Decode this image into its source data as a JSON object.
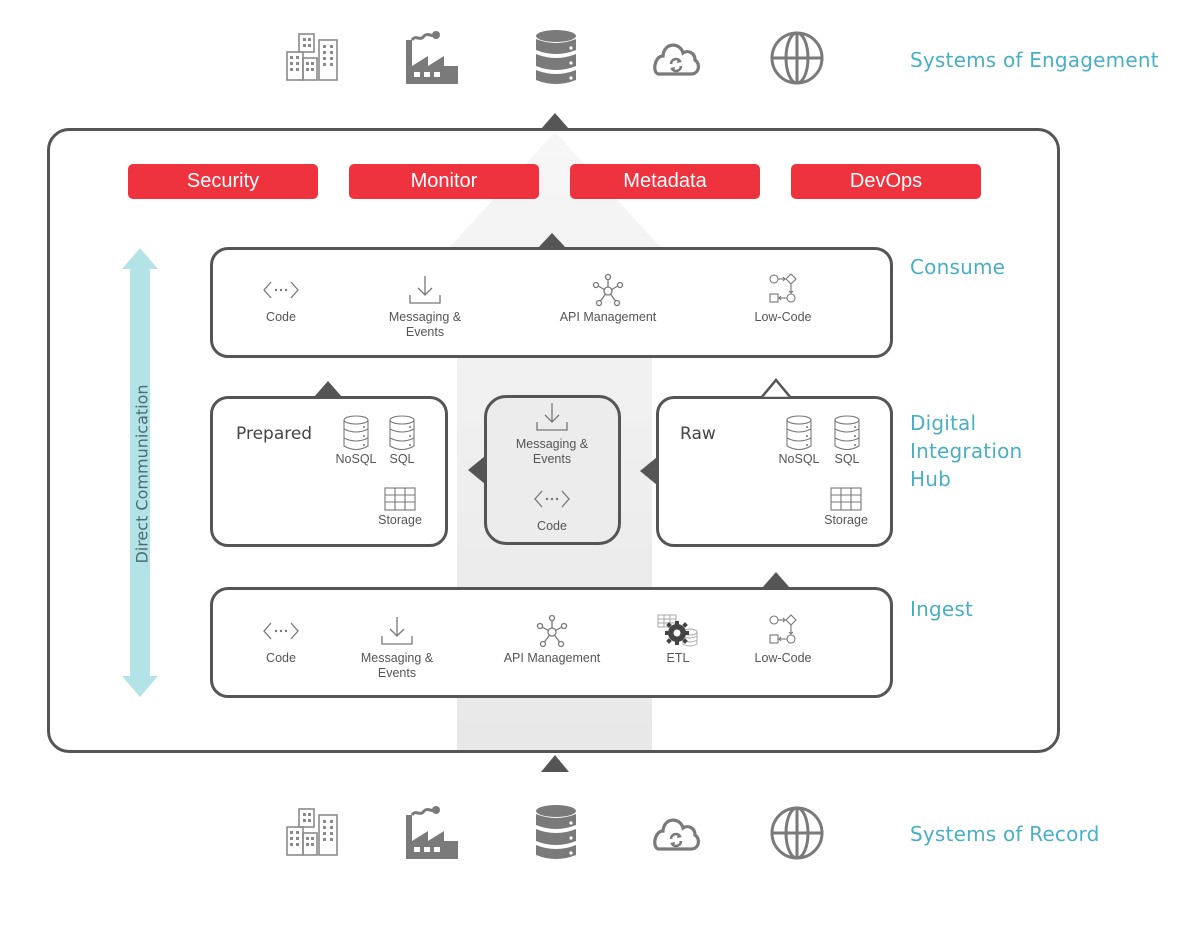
{
  "layers": {
    "engagement": "Systems of Engagement",
    "consume": "Consume",
    "hub_line1": "Digital",
    "hub_line2": "Integration",
    "hub_line3": "Hub",
    "ingest": "Ingest",
    "record": "Systems of Record"
  },
  "systems_icons": [
    "buildings-icon",
    "factory-icon",
    "database-icon",
    "cloud-sync-icon",
    "globe-icon"
  ],
  "capabilities": [
    "Security",
    "Monitor",
    "Metadata",
    "DevOps"
  ],
  "direct_communication": "Direct Communication",
  "consume": {
    "items": [
      {
        "icon": "code-icon",
        "label": "Code"
      },
      {
        "icon": "inbox-download-icon",
        "label_line1": "Messaging &",
        "label_line2": "Events"
      },
      {
        "icon": "api-hub-icon",
        "label": "API Management"
      },
      {
        "icon": "low-code-flow-icon",
        "label": "Low-Code"
      }
    ]
  },
  "hub": {
    "prepared": {
      "title": "Prepared",
      "nosql": "NoSQL",
      "sql": "SQL",
      "storage": "Storage"
    },
    "middle": {
      "messaging_line1": "Messaging &",
      "messaging_line2": "Events",
      "code": "Code"
    },
    "raw": {
      "title": "Raw",
      "nosql": "NoSQL",
      "sql": "SQL",
      "storage": "Storage"
    }
  },
  "ingest": {
    "items": [
      {
        "icon": "code-icon",
        "label": "Code"
      },
      {
        "icon": "inbox-download-icon",
        "label_line1": "Messaging &",
        "label_line2": "Events"
      },
      {
        "icon": "api-hub-icon",
        "label": "API Management"
      },
      {
        "icon": "etl-gear-icon",
        "label": "ETL"
      },
      {
        "icon": "low-code-flow-icon",
        "label": "Low-Code"
      }
    ]
  },
  "colors": {
    "accent_red": "#ee333f",
    "teal_text": "#4aafc4",
    "direct_comm_arrow": "#b3e3e6",
    "frame": "#555555",
    "icon_gray": "#7a7a7a"
  }
}
